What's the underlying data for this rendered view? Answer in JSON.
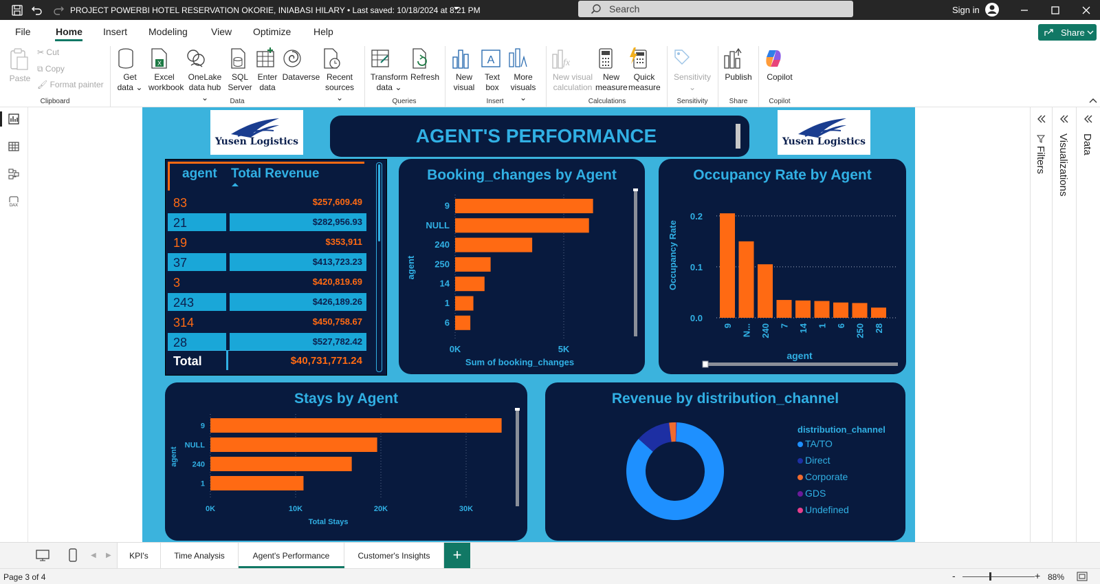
{
  "window": {
    "title": "PROJECT POWERBI HOTEL RESERVATION OKORIE, INIABASI HILARY • Last saved: 10/18/2024 at 8:21 PM",
    "search_placeholder": "Search",
    "sign_in": "Sign in"
  },
  "ribbon_tabs": [
    "File",
    "Home",
    "Insert",
    "Modeling",
    "View",
    "Optimize",
    "Help"
  ],
  "active_tab": "Home",
  "share_label": "Share",
  "ribbon": {
    "clipboard": {
      "paste": "Paste",
      "cut": "Cut",
      "copy": "Copy",
      "format_painter": "Format painter",
      "group": "Clipboard"
    },
    "data": {
      "get_data": [
        "Get",
        "data"
      ],
      "excel": [
        "Excel",
        "workbook"
      ],
      "onelake": [
        "OneLake",
        "data hub"
      ],
      "sql": [
        "SQL",
        "Server"
      ],
      "enter": [
        "Enter",
        "data"
      ],
      "dataverse": [
        "Dataverse"
      ],
      "recent": [
        "Recent",
        "sources"
      ],
      "group": "Data"
    },
    "queries": {
      "transform": [
        "Transform",
        "data"
      ],
      "refresh": [
        "Refresh"
      ],
      "group": "Queries"
    },
    "insert": {
      "new_visual": [
        "New",
        "visual"
      ],
      "text_box": [
        "Text",
        "box"
      ],
      "more_visuals": [
        "More",
        "visuals"
      ],
      "group": "Insert"
    },
    "calculations": {
      "new_visual_calc": [
        "New visual",
        "calculation"
      ],
      "new_measure": [
        "New",
        "measure"
      ],
      "quick_measure": [
        "Quick",
        "measure"
      ],
      "group": "Calculations"
    },
    "sensitivity": {
      "label": "Sensitivity",
      "group": "Sensitivity"
    },
    "share": {
      "publish": "Publish",
      "group": "Share"
    },
    "copilot": {
      "label": "Copilot",
      "group": "Copilot"
    }
  },
  "report": {
    "logo_text": "Yusen Logistics",
    "title": "AGENT'S PERFORMANCE",
    "table": {
      "headers": [
        "agent",
        "Total Revenue"
      ],
      "rows": [
        {
          "agent": "83",
          "revenue": "$257,609.49"
        },
        {
          "agent": "21",
          "revenue": "$282,956.93"
        },
        {
          "agent": "19",
          "revenue": "$353,911"
        },
        {
          "agent": "37",
          "revenue": "$413,723.23"
        },
        {
          "agent": "3",
          "revenue": "$420,819.69"
        },
        {
          "agent": "243",
          "revenue": "$426,189.26"
        },
        {
          "agent": "314",
          "revenue": "$450,758.67"
        },
        {
          "agent": "28",
          "revenue": "$527,782.42"
        }
      ],
      "total_label": "Total",
      "total_value": "$40,731,771.24"
    }
  },
  "chart_data": [
    {
      "type": "bar",
      "orientation": "horizontal",
      "title": "Booking_changes by Agent",
      "categories": [
        "9",
        "NULL",
        "240",
        "250",
        "14",
        "1",
        "6"
      ],
      "values": [
        6800,
        6600,
        3800,
        1750,
        1450,
        900,
        750
      ],
      "xlabel": "Sum of booking_changes",
      "ylabel": "agent",
      "xticks": [
        "0K",
        "5K"
      ],
      "xlim": [
        0,
        8000
      ],
      "color": "#ff6a13"
    },
    {
      "type": "bar",
      "title": "Occupancy Rate by Agent",
      "categories": [
        "9",
        "N...",
        "240",
        "7",
        "14",
        "1",
        "6",
        "250",
        "28"
      ],
      "values": [
        0.205,
        0.15,
        0.105,
        0.035,
        0.034,
        0.033,
        0.03,
        0.029,
        0.02
      ],
      "xlabel": "agent",
      "ylabel": "Occupancy Rate",
      "yticks": [
        "0.0",
        "0.1",
        "0.2"
      ],
      "ylim": [
        0,
        0.22
      ],
      "color": "#ff6a13"
    },
    {
      "type": "bar",
      "orientation": "horizontal",
      "title": "Stays by Agent",
      "categories": [
        "9",
        "NULL",
        "240",
        "1"
      ],
      "values": [
        34400,
        19700,
        16700,
        11000
      ],
      "xlabel": "Total Stays",
      "ylabel": "agent",
      "xticks": [
        "0K",
        "10K",
        "20K",
        "30K"
      ],
      "xlim": [
        0,
        35000
      ],
      "color": "#ff6a13"
    },
    {
      "type": "pie",
      "variant": "donut",
      "title": "Revenue by distribution_channel",
      "legend_title": "distribution_channel",
      "labels": [
        "TA/TO",
        "Direct",
        "Corporate",
        "GDS",
        "Undefined"
      ],
      "values": [
        86,
        11.5,
        2.3,
        0.15,
        0.05
      ],
      "colors": [
        "#1e90ff",
        "#1d2fa3",
        "#ef6b2e",
        "#6a1b9a",
        "#e83e8c"
      ]
    }
  ],
  "right_panes": [
    "Filters",
    "Visualizations",
    "Data"
  ],
  "pages": [
    "KPI's",
    "Time Analysis",
    "Agent's Performance",
    "Customer's Insights"
  ],
  "active_page": "Agent's Performance",
  "status": {
    "page": "Page 3 of 4",
    "zoom": "88%"
  }
}
